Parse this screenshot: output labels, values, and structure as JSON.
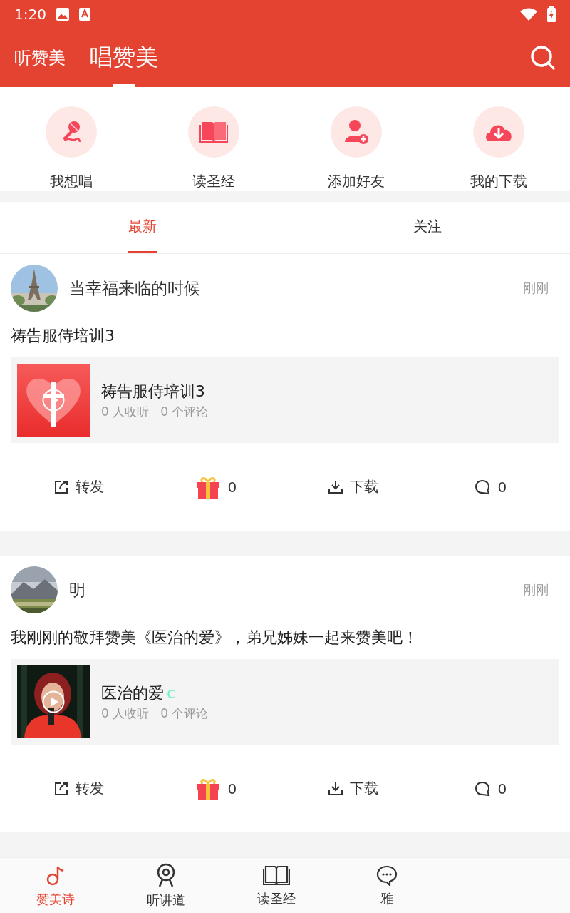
{
  "status_bar": {
    "time": "1:20"
  },
  "header": {
    "tabs": [
      {
        "label": "听赞美",
        "selected": false
      },
      {
        "label": "唱赞美",
        "selected": true
      }
    ]
  },
  "quick_actions": [
    {
      "label": "我想唱",
      "kind": "mic"
    },
    {
      "label": "读圣经",
      "kind": "book"
    },
    {
      "label": "添加好友",
      "kind": "add-user"
    },
    {
      "label": "我的下载",
      "kind": "download"
    }
  ],
  "feed_tabs": [
    {
      "label": "最新",
      "selected": true
    },
    {
      "label": "关注",
      "selected": false
    }
  ],
  "posts": [
    {
      "user": "当幸福来临的时候",
      "time": "刚刚",
      "text": "祷告服侍培训3",
      "media": {
        "title": "祷告服侍培训3",
        "listeners": "0 人收听",
        "comments": "0 个评论"
      },
      "actions": {
        "share": "转发",
        "gifts": "0",
        "download": "下载",
        "comment_count": "0"
      }
    },
    {
      "user": "明",
      "time": "刚刚",
      "text": "我刚刚的敬拜赞美《医治的爱》，弟兄姊妹一起来赞美吧！",
      "media": {
        "title": "医治的爱",
        "title_suffix": "c",
        "listeners": "0 人收听",
        "comments": "0 个评论"
      },
      "actions": {
        "share": "转发",
        "gifts": "0",
        "download": "下载",
        "comment_count": "0"
      }
    }
  ],
  "bottom_nav": [
    {
      "label": "赞美诗",
      "kind": "note",
      "selected": true
    },
    {
      "label": "听讲道",
      "kind": "webcam",
      "selected": false
    },
    {
      "label": "读圣经",
      "kind": "book",
      "selected": false
    },
    {
      "label": "雅",
      "kind": "chat",
      "selected": false
    }
  ]
}
